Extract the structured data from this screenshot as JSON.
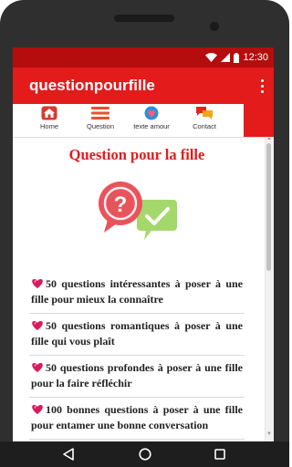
{
  "status_bar": {
    "time": "12:30"
  },
  "app_bar": {
    "title": "questionpourfille"
  },
  "tabs": [
    {
      "label": "Home",
      "icon": "home-icon"
    },
    {
      "label": "Question",
      "icon": "menu-lines-icon"
    },
    {
      "label": "texte amour",
      "icon": "heart-globe-icon"
    },
    {
      "label": "Contact",
      "icon": "chat-bubbles-icon"
    }
  ],
  "content": {
    "heading": "Question pour la fille",
    "questions": [
      "50 questions intéressantes à poser à une fille pour mieux la connaître",
      "50 questions romantiques à poser à une fille qui vous plaît",
      "50 questions profondes à poser à une fille pour la faire réfléchir",
      "100 bonnes questions à poser à une fille pour entamer une bonne conversation"
    ]
  },
  "colors": {
    "accent": "#e31b1b",
    "status_bar": "#b50d0d",
    "question_bubble": "#e8535c",
    "check_bubble": "#a5d86b"
  }
}
